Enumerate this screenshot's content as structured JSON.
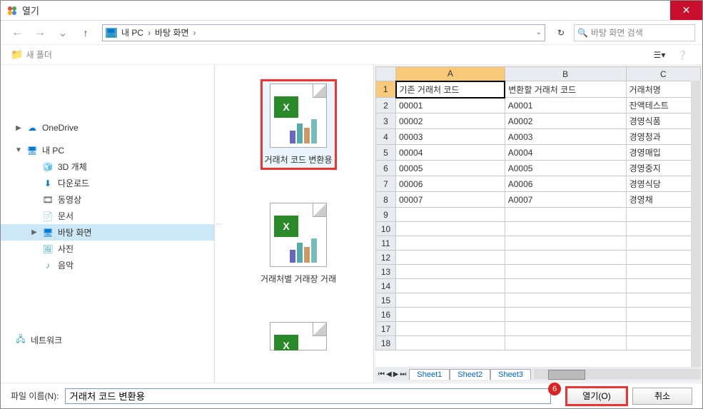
{
  "window": {
    "title": "열기"
  },
  "nav": {
    "path_root": "내 PC",
    "path_seg": "바탕 화면",
    "search_placeholder": "바탕 화면 검색"
  },
  "toolbar": {
    "new_folder": "새 폴더"
  },
  "tree": {
    "onedrive": "OneDrive",
    "mypc": "내 PC",
    "objects3d": "3D 개체",
    "downloads": "다운로드",
    "videos": "동영상",
    "documents": "문서",
    "desktop": "바탕 화면",
    "pictures": "사진",
    "music": "음악",
    "network": "네트워크"
  },
  "files": {
    "file1": "거래처 코드 변환용",
    "file2": "거래처별 거래장 거래"
  },
  "chart_data": {
    "type": "table",
    "title": "",
    "columns": [
      "",
      "A",
      "B",
      "C"
    ],
    "headers_row": [
      "기존 거래처 코드",
      "변환할 거래처 코드",
      "거래처명"
    ],
    "rows": [
      [
        "00001",
        "A0001",
        "잔액테스트"
      ],
      [
        "00002",
        "A0002",
        "경영식품"
      ],
      [
        "00003",
        "A0003",
        "경영청과"
      ],
      [
        "00004",
        "A0004",
        "경영매입"
      ],
      [
        "00005",
        "A0005",
        "경영중지"
      ],
      [
        "00006",
        "A0006",
        "경영식당"
      ],
      [
        "00007",
        "A0007",
        "경영채"
      ]
    ],
    "empty_row_start": 9,
    "empty_row_end": 18,
    "sheets": [
      "Sheet1",
      "Sheet2",
      "Sheet3"
    ]
  },
  "footer": {
    "filename_label": "파일 이름(N):",
    "filename_value": "거래처 코드 변환용",
    "open": "열기(O)",
    "cancel": "취소",
    "callout": "6"
  }
}
